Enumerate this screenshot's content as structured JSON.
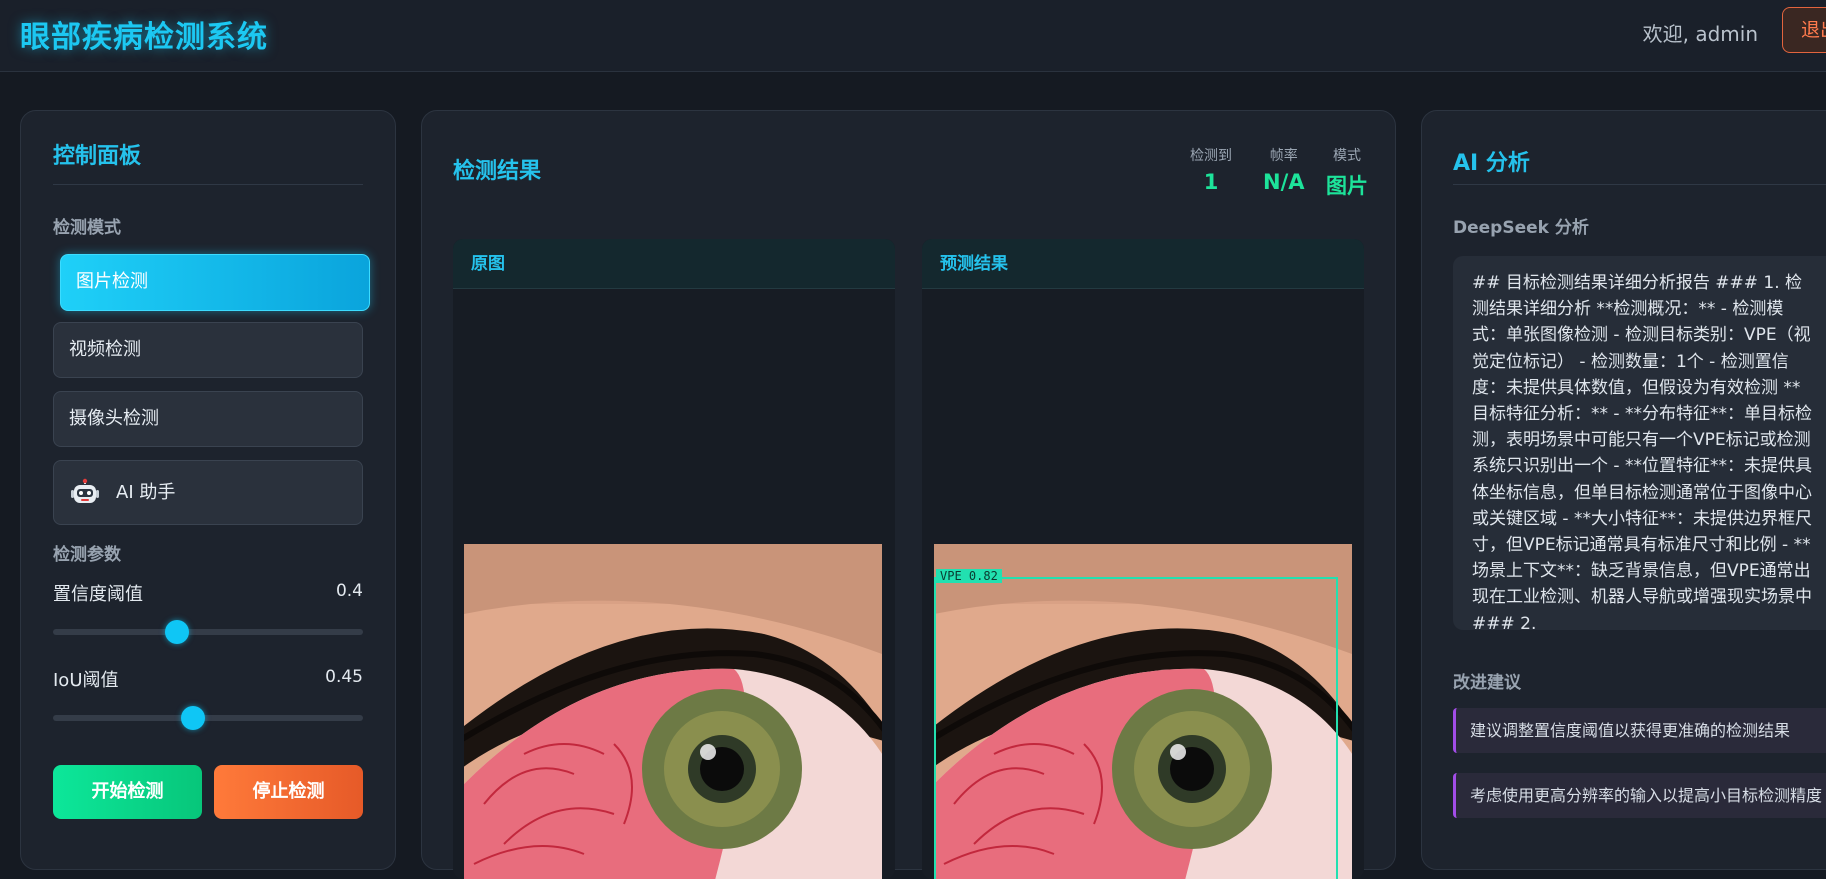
{
  "header": {
    "title": "眼部疾病检测系统",
    "welcome": "欢迎, admin",
    "logout_label": "退出"
  },
  "control_panel": {
    "title": "控制面板",
    "mode_section_label": "检测模式",
    "modes": [
      {
        "label": "图片检测",
        "active": true
      },
      {
        "label": "视频检测",
        "active": false
      },
      {
        "label": "摄像头检测",
        "active": false
      },
      {
        "label": "AI 助手",
        "active": false,
        "icon": "robot-icon"
      }
    ],
    "params_section_label": "检测参数",
    "confidence": {
      "label": "置信度阈值",
      "value": "0.4",
      "level": 0.4
    },
    "iou": {
      "label": "IoU阈值",
      "value": "0.45",
      "level": 0.45
    },
    "start_label": "开始检测",
    "stop_label": "停止检测"
  },
  "results": {
    "title": "检测结果",
    "stats": [
      {
        "label": "检测到",
        "value": "1"
      },
      {
        "label": "帧率",
        "value": "N/A"
      },
      {
        "label": "模式",
        "value": "图片"
      }
    ],
    "original_title": "原图",
    "prediction_title": "预测结果",
    "detection_label": "VPE 0.82"
  },
  "ai_panel": {
    "title": "AI 分析",
    "subtitle": "DeepSeek 分析",
    "analysis_text": "## 目标检测结果详细分析报告 ### 1. 检测结果详细分析 **检测概况：** - 检测模式：单张图像检测 - 检测目标类别：VPE（视觉定位标记） - 检测数量：1个 - 检测置信度：未提供具体数值，但假设为有效检测 **目标特征分析：** - **分布特征**：单目标检测，表明场景中可能只有一个VPE标记或检测系统只识别出一个 - **位置特征**：未提供具体坐标信息，但单目标检测通常位于图像中心或关键区域 - **大小特征**：未提供边界框尺寸，但VPE标记通常具有标准尺寸和比例 - **场景上下文**：缺乏背景信息，但VPE通常出现在工业检测、机器人导航或增强现实场景中 ### 2.",
    "suggestions_label": "改进建议",
    "suggestions": [
      "建议调整置信度阈值以获得更准确的检测结果",
      "考虑使用更高分辨率的输入以提高小目标检测精度"
    ]
  },
  "colors": {
    "accent": "#1cc8f2",
    "success": "#1de39a",
    "danger": "#e65a28",
    "box": "#22e0b0"
  }
}
